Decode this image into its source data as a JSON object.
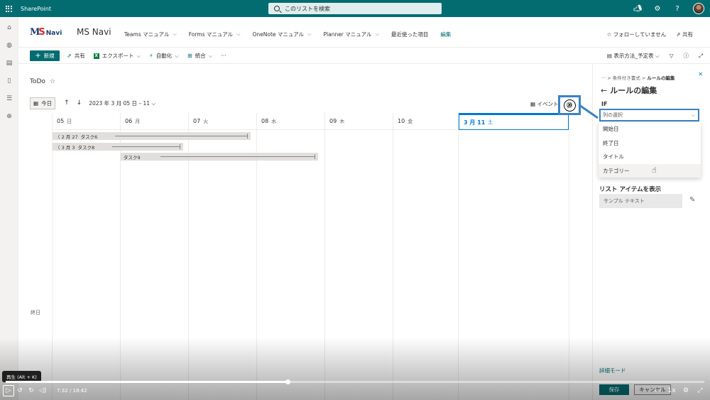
{
  "suite": {
    "app_name": "SharePoint",
    "search_placeholder": "このリストを検索"
  },
  "site": {
    "logo_m": "M",
    "logo_s": "S",
    "logo_navi": "Navi",
    "name": "MS Navi",
    "nav": [
      {
        "label": "Teams マニュアル",
        "chevron": true
      },
      {
        "label": "Forms マニュアル",
        "chevron": true
      },
      {
        "label": "OneNote マニュアル",
        "chevron": true
      },
      {
        "label": "Planner マニュアル",
        "chevron": true
      },
      {
        "label": "最近使った項目",
        "chevron": false
      }
    ],
    "edit_label": "編集",
    "follow_label": "☆ フォローしていません",
    "share_label": "共有"
  },
  "command_bar": {
    "new_label": "新規",
    "share_label": "共有",
    "export_label": "エクスポート",
    "automate_label": "自動化",
    "integrate_label": "統合",
    "more_label": "···",
    "view_label": "表示方法_予定表"
  },
  "list": {
    "title": "ToDo",
    "today_label": "今日",
    "range_label": "2023 年 3 月 05 日 – 11",
    "events_label": "イベント"
  },
  "calendar": {
    "allday_label": "終日",
    "days": [
      {
        "day": "05",
        "weekday": "日",
        "today": false
      },
      {
        "day": "06",
        "weekday": "月",
        "today": false
      },
      {
        "day": "07",
        "weekday": "火",
        "today": false
      },
      {
        "day": "08",
        "weekday": "水",
        "today": false
      },
      {
        "day": "09",
        "weekday": "木",
        "today": false
      },
      {
        "day": "10",
        "weekday": "金",
        "today": false
      },
      {
        "day": "3 月 11",
        "weekday": "土",
        "today": true
      }
    ],
    "events": [
      {
        "date": "〈 2 月 27",
        "title": "タスク6"
      },
      {
        "date": "〈 3 月 3",
        "title": "タスク8"
      },
      {
        "date": "",
        "title": "タスク9"
      }
    ]
  },
  "panel": {
    "crumb_more": "···",
    "crumb_parent": "条件付き書式",
    "crumb_current": "ルールの編集",
    "title": "ルールの編集",
    "if_label": "IF",
    "select_value": "列の選択",
    "options": [
      "開始日",
      "終了日",
      "タイトル",
      "カテゴリー"
    ],
    "show_label": "リスト アイテムを表示",
    "sample_text": "サンプル テキスト",
    "detail_mode": "詳細モード",
    "save_label": "保存",
    "cancel_label": "キャンセル"
  },
  "annotation": {
    "number": "⑳"
  },
  "video": {
    "tooltip": "再生 (Alt + K)",
    "time": "7:32 / 18:42",
    "progress": 0.403,
    "speed": "1x"
  }
}
